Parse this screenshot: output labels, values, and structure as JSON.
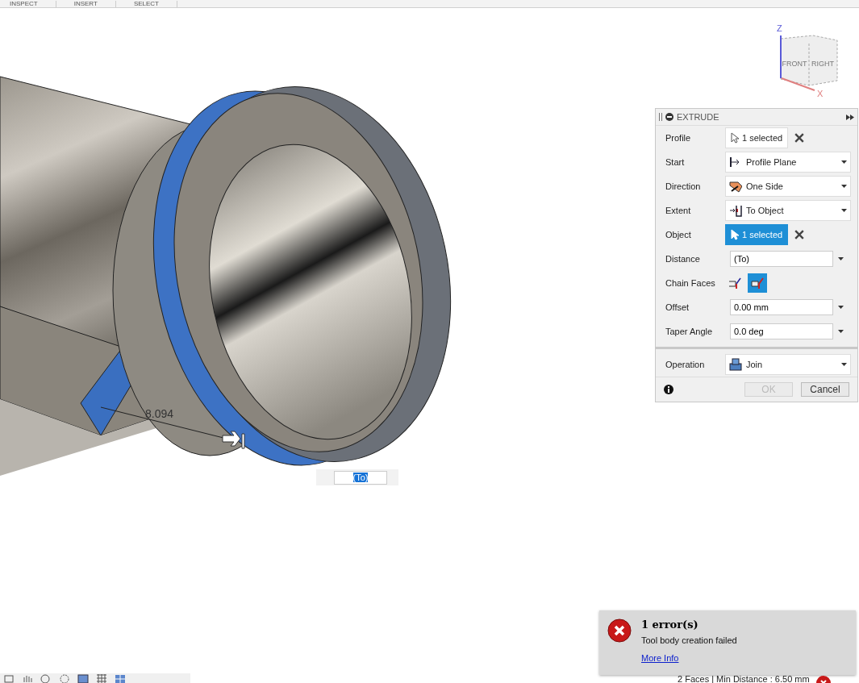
{
  "toolbar": {
    "tabs": [
      {
        "label": "INSPECT"
      },
      {
        "label": "INSERT"
      },
      {
        "label": "SELECT"
      }
    ]
  },
  "viewcube": {
    "faces": [
      "FRONT",
      "RIGHT"
    ],
    "axes": [
      "Z",
      "X"
    ]
  },
  "viewport": {
    "dimension": "8.094",
    "distance_input": {
      "value": "(To)"
    }
  },
  "extrude_panel": {
    "title": "EXTRUDE",
    "rows": [
      {
        "kind": "select",
        "label": "Profile",
        "value": "1 selected",
        "active": false
      },
      {
        "kind": "dropdown",
        "label": "Start",
        "value": "Profile Plane"
      },
      {
        "kind": "dropdown",
        "label": "Direction",
        "value": "One Side"
      },
      {
        "kind": "dropdown",
        "label": "Extent",
        "value": "To Object"
      },
      {
        "kind": "select",
        "label": "Object",
        "value": "1 selected",
        "active": true
      },
      {
        "kind": "input",
        "label": "Distance",
        "value": "(To)"
      },
      {
        "kind": "toggle",
        "label": "Chain Faces",
        "options": [
          {
            "selected": false
          },
          {
            "selected": true
          }
        ]
      },
      {
        "kind": "input",
        "label": "Offset",
        "value": "0.00 mm"
      },
      {
        "kind": "input",
        "label": "Taper Angle",
        "value": "0.0 deg"
      },
      {
        "kind": "separator"
      },
      {
        "kind": "dropdown",
        "label": "Operation",
        "value": "Join"
      }
    ],
    "buttons": [
      {
        "label": "OK",
        "disabled": true
      },
      {
        "label": "Cancel",
        "disabled": false
      }
    ]
  },
  "error": {
    "title": "1 error(s)",
    "message": "Tool body creation failed",
    "link": "More Info"
  },
  "status_bar": {
    "text": "2 Faces | Min Distance : 6.50 mm"
  }
}
